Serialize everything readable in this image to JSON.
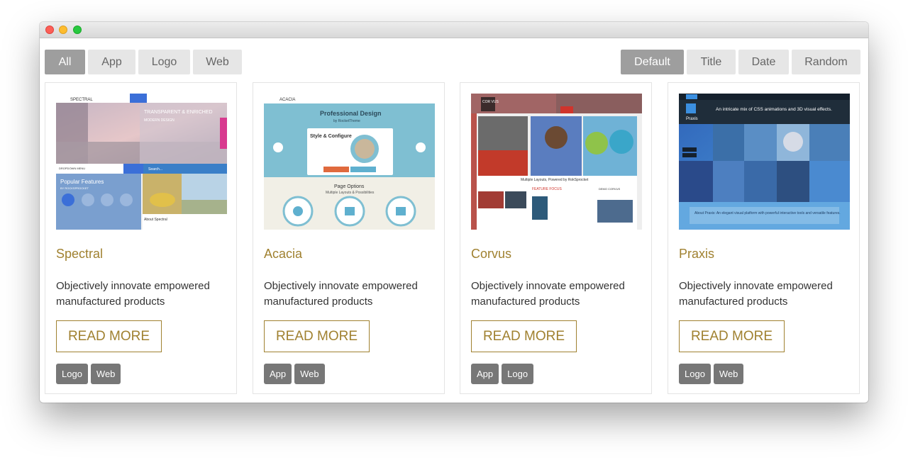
{
  "filters": [
    "All",
    "App",
    "Logo",
    "Web"
  ],
  "sorts": [
    "Default",
    "Title",
    "Date",
    "Random"
  ],
  "read_more_label": "READ MORE",
  "colors": {
    "accent": "#a08130",
    "active_button": "#9e9e9e",
    "tag": "#777777"
  },
  "cards": [
    {
      "title": "Spectral",
      "description": "Objectively innovate empowered manufactured products",
      "tags": [
        "Logo",
        "Web"
      ],
      "thumb": {
        "brand": "SPECTRAL",
        "hero_heading": "TRANSPARENT & ENRICHED",
        "hero_sub": "MODERN DESIGN",
        "menu": "DROPDOWN MENU",
        "search": "Search...",
        "features": "Popular Features",
        "features_by": "BY ROCKSPROCKET",
        "about": "About Spectral"
      }
    },
    {
      "title": "Acacia",
      "description": "Objectively innovate empowered manufactured products",
      "tags": [
        "App",
        "Web"
      ],
      "thumb": {
        "brand": "ACACIA",
        "heading": "Professional Design",
        "heading_sub": "by RocketTheme",
        "panel_title": "Style & Configure",
        "page_options": "Page Options",
        "page_options_sub": "Multiple Layouts & Possibilities"
      }
    },
    {
      "title": "Corvus",
      "description": "Objectively innovate empowered manufactured products",
      "tags": [
        "App",
        "Logo"
      ],
      "thumb": {
        "brand": "COR VUS",
        "tagline": "Multiple Layouts, Powered by RokSprocket",
        "feature": "FEATURE FOCUS",
        "demo": "DEMO CORVUS"
      }
    },
    {
      "title": "Praxis",
      "description": "Objectively innovate empowered manufactured products",
      "tags": [
        "Logo",
        "Web"
      ],
      "thumb": {
        "brand": "Praxis",
        "heading": "An intricate mix of CSS animations and 3D visual effects.",
        "about": "About Praxis: An elegant visual platform with powerful interactive tools and versatile features."
      }
    }
  ]
}
